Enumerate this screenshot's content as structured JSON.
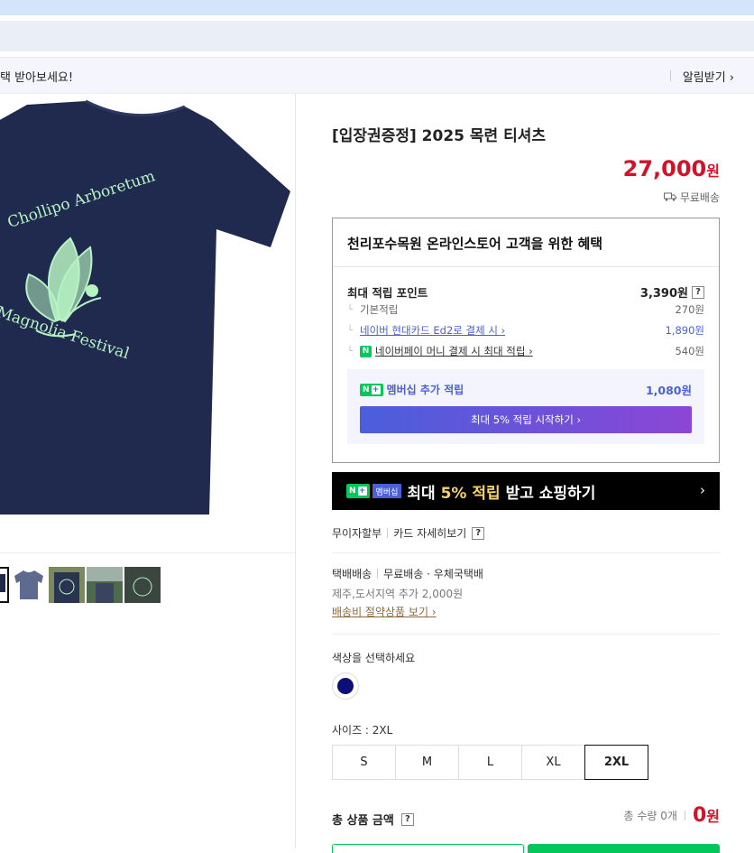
{
  "notice": {
    "text": "택 받아보세요!",
    "alarm_label": "알림받기 ›"
  },
  "product": {
    "title": "[입장권증정] 2025 목련 티셔츠",
    "price": "27,000",
    "price_unit": "원",
    "shipping_badge": "무료배송",
    "shirt_text_top": "Chollipo Arboretum",
    "shirt_text_bottom": "Magnolia Festival"
  },
  "benefit": {
    "title": "천리포수목원 온라인스토어 고객을 위한 혜택",
    "max_points_label": "최대 적립 포인트",
    "max_points_value": "3,390원",
    "rows": [
      {
        "label": "기본적립",
        "value": "270원"
      },
      {
        "label": "네이버 현대카드 Ed2로 결제 시 ›",
        "value": "1,890원"
      },
      {
        "label": "네이버페이 머니 결제 시 최대 적립 ›",
        "value": "540원"
      }
    ],
    "membership_label": "멤버십 추가 적립",
    "membership_value": "1,080원",
    "membership_button": "최대 5% 적립 시작하기 ›"
  },
  "banner": {
    "tag": "멤버십",
    "text_pre": "최대 ",
    "text_hl": "5% 적립",
    "text_post": " 받고 쇼핑하기",
    "chevron": "›"
  },
  "payment": {
    "installment": "무이자할부",
    "card_detail": "카드 자세히보기"
  },
  "shipping": {
    "method": "택배배송",
    "detail": "무료배송 · 우체국택배",
    "extra": "제주,도서지역 추가 2,000원",
    "saver_link": "배송비 절약상품 보기 ›"
  },
  "options": {
    "color_label": "색상을 선택하세요",
    "size_label": "사이즈 : 2XL",
    "sizes": [
      "S",
      "M",
      "L",
      "XL",
      "2XL"
    ],
    "selected_size": "2XL",
    "swatch_color": "#0a1077"
  },
  "total": {
    "label": "총 상품 금액",
    "qty": "총 수량 0개",
    "amount": "0",
    "unit": "원"
  },
  "colors": {
    "price_red": "#d1132a",
    "naver_green": "#03c75a",
    "accent_blue": "#4b5fd6",
    "shirt_navy": "#1f2a4e",
    "print_mint": "#b7f2c3"
  }
}
